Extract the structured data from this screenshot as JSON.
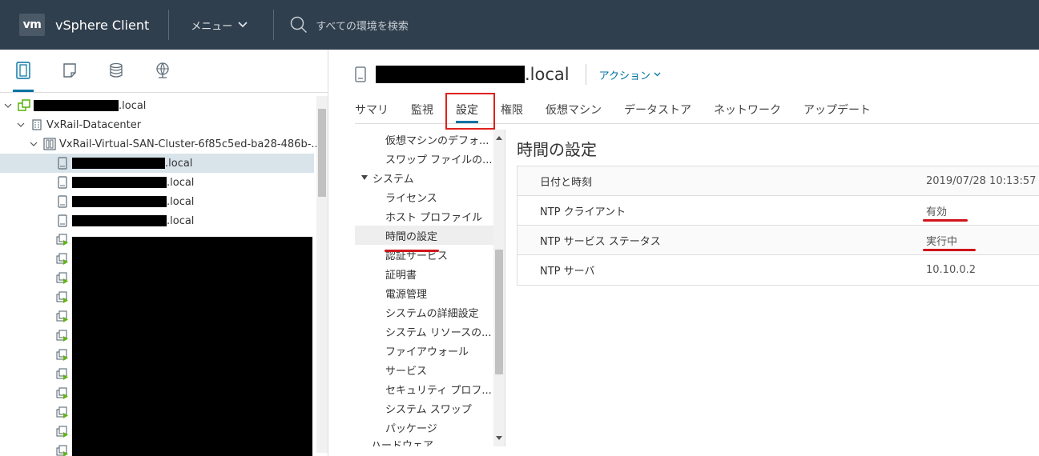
{
  "header": {
    "logo": "vm",
    "app_title": "vSphere Client",
    "menu_label": "メニュー",
    "search_placeholder": "すべての環境を検索"
  },
  "left_tabs": [
    {
      "icon": "hosts-clusters-icon"
    },
    {
      "icon": "vms-templates-icon"
    },
    {
      "icon": "storage-icon"
    },
    {
      "icon": "networking-icon"
    }
  ],
  "tree": {
    "vcenter": {
      "suffix": ".local"
    },
    "datacenter": {
      "label": "VxRail-Datacenter"
    },
    "cluster": {
      "label": "VxRail-Virtual-SAN-Cluster-6f85c5ed-ba28-486b-..."
    },
    "hosts": [
      {
        "suffix": ".local"
      },
      {
        "suffix": ".local"
      },
      {
        "suffix": ".local"
      },
      {
        "suffix": ".local"
      }
    ]
  },
  "object": {
    "name_suffix": ".local",
    "actions_label": "アクション"
  },
  "tabs": [
    {
      "label": "サマリ"
    },
    {
      "label": "監視"
    },
    {
      "label": "設定"
    },
    {
      "label": "権限"
    },
    {
      "label": "仮想マシン"
    },
    {
      "label": "データストア"
    },
    {
      "label": "ネットワーク"
    },
    {
      "label": "アップデート"
    }
  ],
  "subnav": {
    "items_top": [
      "仮想マシンのデフォ...",
      "スワップ ファイルの..."
    ],
    "group": "システム",
    "items": [
      "ライセンス",
      "ホスト プロファイル",
      "時間の設定",
      "認証サービス",
      "証明書",
      "電源管理",
      "システムの詳細設定",
      "システム リソースの...",
      "ファイアウォール",
      "サービス",
      "セキュリティ プロフ...",
      "システム スワップ",
      "パッケージ"
    ],
    "next_group": "ハードウェア"
  },
  "content": {
    "title": "時間の設定",
    "rows": [
      {
        "label": "日付と時刻",
        "value": "2019/07/28 10:13:57"
      },
      {
        "label": "NTP クライアント",
        "value": "有効"
      },
      {
        "label": "NTP サービス ステータス",
        "value": "実行中"
      },
      {
        "label": "NTP サーバ",
        "value": "10.10.0.2"
      }
    ]
  },
  "colors": {
    "header_bg": "#303f4d",
    "accent": "#0072a3",
    "annotation_red": "#d0141b"
  }
}
